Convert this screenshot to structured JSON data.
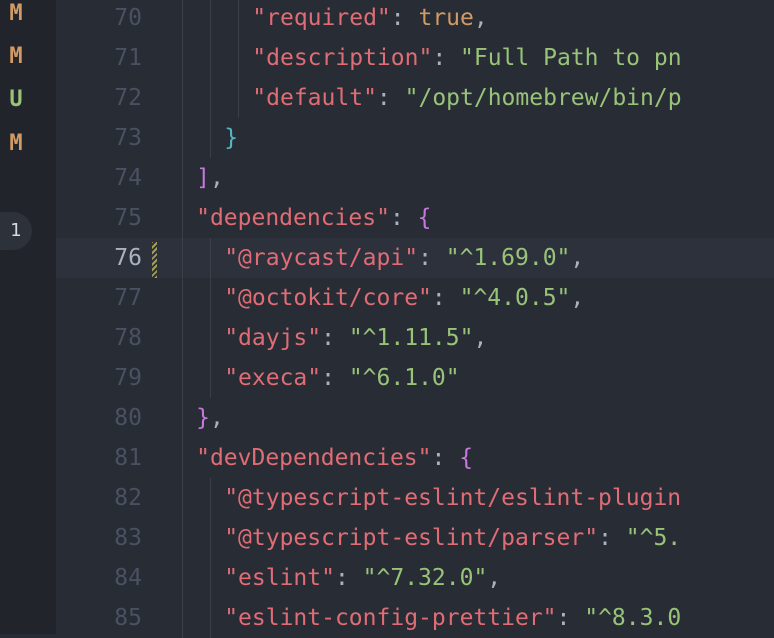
{
  "scm": {
    "letters": [
      "M",
      "M",
      "U",
      "M"
    ],
    "colors": {
      "modified": "#d19a66",
      "untracked": "#98c379"
    },
    "problems_badge": "1"
  },
  "lines": [
    {
      "n": "70",
      "key": "\"required\"",
      "sep": ": ",
      "val": "true",
      "tail": ","
    },
    {
      "n": "71",
      "key": "\"description\"",
      "sep": ": ",
      "val": "\"Full Path to pn",
      "tail": ""
    },
    {
      "n": "72",
      "key": "\"default\"",
      "sep": ": ",
      "val": "\"/opt/homebrew/bin/p",
      "tail": ""
    },
    {
      "n": "73",
      "text": "}"
    },
    {
      "n": "74",
      "text": "],"
    },
    {
      "n": "75",
      "key": "\"dependencies\"",
      "sep": ": ",
      "text": "{"
    },
    {
      "n": "76",
      "key": "\"@raycast/api\"",
      "sep": ": ",
      "val": "\"^1.69.0\"",
      "tail": ","
    },
    {
      "n": "77",
      "key": "\"@octokit/core\"",
      "sep": ": ",
      "val": "\"^4.0.5\"",
      "tail": ","
    },
    {
      "n": "78",
      "key": "\"dayjs\"",
      "sep": ": ",
      "val": "\"^1.11.5\"",
      "tail": ","
    },
    {
      "n": "79",
      "key": "\"execa\"",
      "sep": ": ",
      "val": "\"^6.1.0\"",
      "tail": ""
    },
    {
      "n": "80",
      "text": "},"
    },
    {
      "n": "81",
      "key": "\"devDependencies\"",
      "sep": ": ",
      "text": "{"
    },
    {
      "n": "82",
      "key": "\"@typescript-eslint/eslint-plugin",
      "sep": "",
      "val": "",
      "tail": ""
    },
    {
      "n": "83",
      "key": "\"@typescript-eslint/parser\"",
      "sep": ": ",
      "val": "\"^5.",
      "tail": ""
    },
    {
      "n": "84",
      "key": "\"eslint\"",
      "sep": ": ",
      "val": "\"^7.32.0\"",
      "tail": ","
    },
    {
      "n": "85",
      "key": "\"eslint-config-prettier\"",
      "sep": ": ",
      "val": "\"^8.3.0",
      "tail": ""
    }
  ],
  "current_line": "76"
}
